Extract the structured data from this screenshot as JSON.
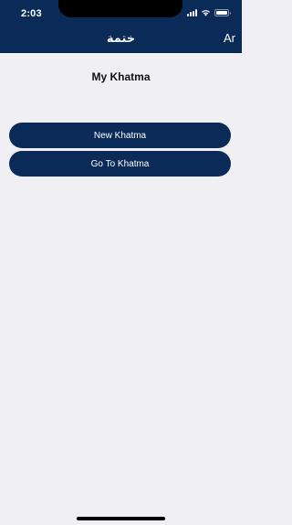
{
  "status_bar": {
    "time": "2:03",
    "icons": [
      "signal-icon",
      "wifi-icon",
      "battery-icon"
    ],
    "battery_level": 1.0
  },
  "nav": {
    "title": "ختمة",
    "language_button": "Ar"
  },
  "main": {
    "heading": "My Khatma",
    "buttons": [
      {
        "label": "New Khatma"
      },
      {
        "label": "Go To Khatma"
      }
    ]
  },
  "colors": {
    "primary": "#0a2a57",
    "background": "#f0f0f4",
    "text_on_primary": "#ffffff",
    "heading_text": "#111111"
  }
}
